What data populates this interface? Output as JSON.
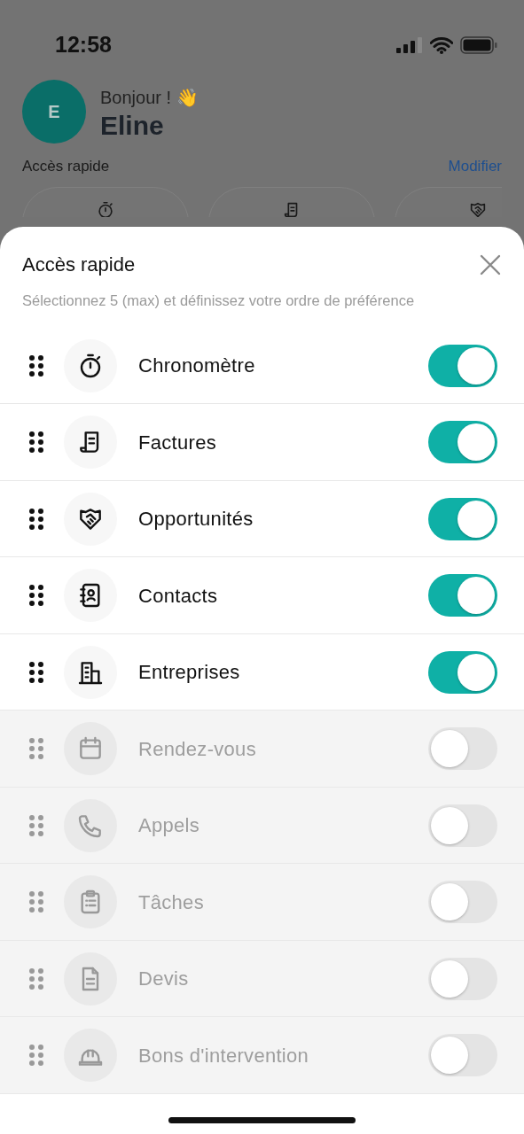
{
  "status_bar": {
    "time": "12:58"
  },
  "header": {
    "avatar_initial": "E",
    "greeting": "Bonjour ! 👋",
    "name": "Eline",
    "section_title": "Accès rapide",
    "edit_link": "Modifier"
  },
  "sheet": {
    "title": "Accès rapide",
    "subtitle": "Sélectionnez 5 (max) et définissez votre ordre de préférence",
    "items": [
      {
        "label": "Chronomètre",
        "on": true
      },
      {
        "label": "Factures",
        "on": true
      },
      {
        "label": "Opportunités",
        "on": true
      },
      {
        "label": "Contacts",
        "on": true
      },
      {
        "label": "Entreprises",
        "on": true
      },
      {
        "label": "Rendez-vous",
        "on": false
      },
      {
        "label": "Appels",
        "on": false
      },
      {
        "label": "Tâches",
        "on": false
      },
      {
        "label": "Devis",
        "on": false
      },
      {
        "label": "Bons d'intervention",
        "on": false
      }
    ]
  }
}
